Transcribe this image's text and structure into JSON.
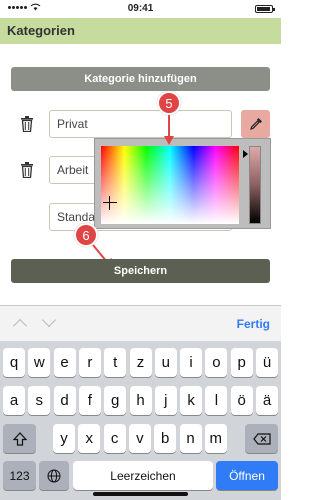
{
  "status_bar": {
    "time": "09:41"
  },
  "header": {
    "title": "Kategorien"
  },
  "add_button": {
    "label": "Kategorie hinzufügen"
  },
  "categories": [
    {
      "name": "Privat"
    },
    {
      "name": "Arbeit"
    },
    {
      "name": "Standa"
    }
  ],
  "color_picker": {
    "selected_color": "#e8a9a0"
  },
  "callouts": [
    {
      "number": "5"
    },
    {
      "number": "6"
    }
  ],
  "save_button": {
    "label": "Speichern"
  },
  "keyboard": {
    "done_label": "Fertig",
    "row1": [
      "q",
      "w",
      "e",
      "r",
      "t",
      "z",
      "u",
      "i",
      "o",
      "p",
      "ü"
    ],
    "row2": [
      "a",
      "s",
      "d",
      "f",
      "g",
      "h",
      "j",
      "k",
      "l",
      "ö",
      "ä"
    ],
    "row3": [
      "y",
      "x",
      "c",
      "v",
      "b",
      "n",
      "m"
    ],
    "numbers_label": "123",
    "space_label": "Leerzeichen",
    "return_label": "Öffnen",
    "icons": [
      "shift-icon",
      "backspace-icon",
      "globe-icon"
    ]
  }
}
